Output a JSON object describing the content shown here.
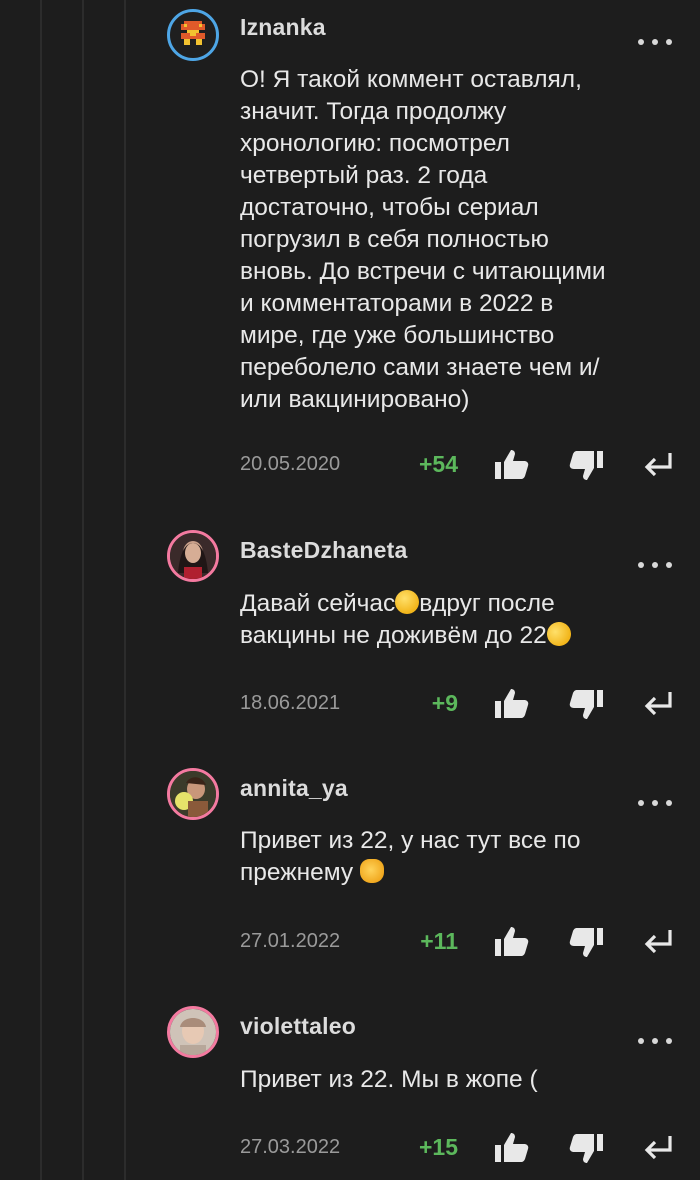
{
  "comments": [
    {
      "username": "Iznanka",
      "text_lines": [
        "О! Я такой коммент оставлял,",
        "значит. Тогда продолжу",
        "хронологию: посмотрел",
        "четвертый раз. 2 года",
        "достаточно, чтобы сериал",
        "погрузил в себя полностью",
        "вновь. До встречи с читающими",
        "и комментаторами в 2022 в",
        "мире, где уже большинство",
        "переболело сами знаете чем и/",
        "или вакцинировано)"
      ],
      "date": "20.05.2020",
      "rating": "+54",
      "avatar_icon": "pixel-robot-icon",
      "avatar_ring_color": "#4ea6e6"
    },
    {
      "username": "BasteDzhaneta",
      "text_lines": [
        "Давай сейчас",
        "вдруг после",
        "вакцины не доживём до 22"
      ],
      "date": "18.06.2021",
      "rating": "+9",
      "emoji_1": "grinning-face-emoji",
      "emoji_2": "rolling-laughing-emoji",
      "avatar_ring_color": "#f47aa0"
    },
    {
      "username": "annita_ya",
      "text_lines": [
        "Привет из 22, у нас тут все по",
        "прежнему"
      ],
      "date": "27.01.2022",
      "rating": "+11",
      "emoji_1": "cat-tears-of-joy-emoji",
      "avatar_ring_color": "#f47aa0"
    },
    {
      "username": "violettaleo",
      "text_lines": [
        "Привет из 22. Мы в жопе ("
      ],
      "date": "27.03.2022",
      "rating": "+15",
      "avatar_ring_color": "#f47aa0"
    }
  ],
  "icons": {
    "more": "more-options-icon",
    "upvote": "thumbs-up-icon",
    "downvote": "thumbs-down-icon",
    "reply": "reply-arrow-icon"
  },
  "colors": {
    "background": "#1d1d1d",
    "rating_positive": "#5cb85c",
    "date": "#9a9a9a",
    "text": "#e8e8e8"
  }
}
